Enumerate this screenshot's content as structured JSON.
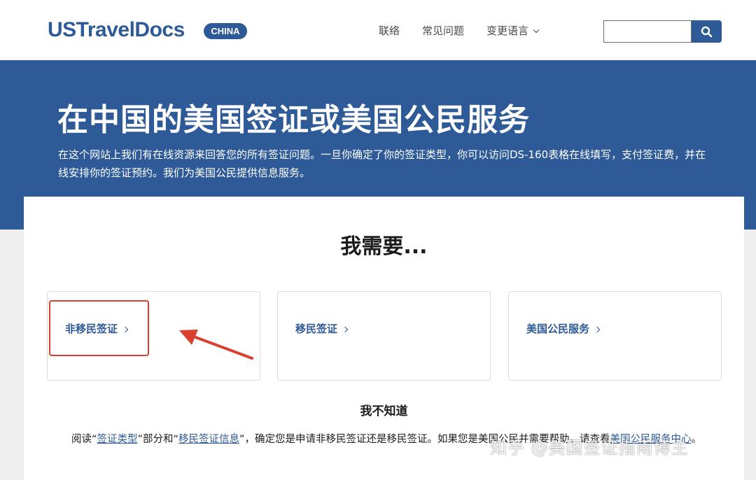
{
  "header": {
    "logo": "USTravelDocs",
    "country_badge": "CHINA",
    "nav": {
      "contact": "联络",
      "faq": "常见问题",
      "language": "变更语言"
    },
    "search": {
      "value": "",
      "placeholder": ""
    }
  },
  "hero": {
    "title": "在中国的美国签证或美国公民服务",
    "description": "在这个网站上我们有在线资源来回答您的所有签证问题。一旦你确定了你的签证类型，你可以访问DS-160表格在线填写，支付签证费，并在线安排你的签证预约。我们为美国公民提供信息服务。"
  },
  "main": {
    "title": "我需要...",
    "options": [
      {
        "label": "非移民签证"
      },
      {
        "label": "移民签证"
      },
      {
        "label": "美国公民服务"
      }
    ],
    "dont_know": "我不知道",
    "help": {
      "t1": "阅读“",
      "link_visa_types": "签证类型",
      "t2": "”部分和“",
      "link_immigrant_info": "移民签证信息",
      "t3": "”，确定您是申请非移民签证还是移民签证。如果您是美国公民并需要帮助，请查看",
      "link_acs_center": "美国公民服务中心",
      "t4": "。"
    }
  },
  "watermark": "知乎 @美国签证指南博主",
  "colors": {
    "brand": "#2e5a97",
    "annotation": "#d9402f"
  }
}
